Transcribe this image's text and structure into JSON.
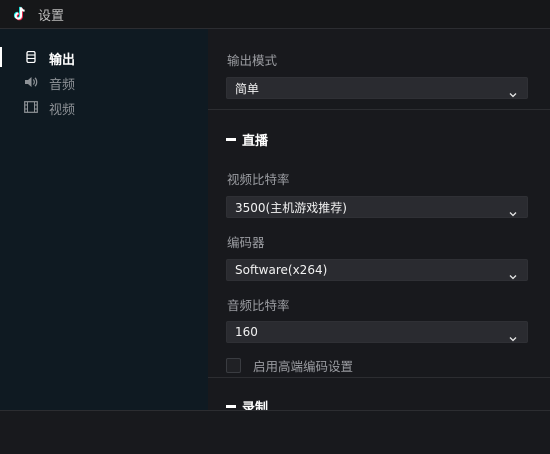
{
  "window": {
    "title": "设置",
    "app_icon": "tiktok-logo-icon"
  },
  "sidebar": {
    "items": [
      {
        "label": "输出",
        "icon": "output-icon",
        "active": true
      },
      {
        "label": "音频",
        "icon": "speaker-icon",
        "active": false
      },
      {
        "label": "视频",
        "icon": "film-icon",
        "active": false
      }
    ]
  },
  "main": {
    "output_mode": {
      "label": "输出模式",
      "value": "简单"
    },
    "live_section": {
      "title": "直播",
      "video_bitrate": {
        "label": "视频比特率",
        "value": "3500(主机游戏推荐)"
      },
      "encoder": {
        "label": "编码器",
        "value": "Software(x264)"
      },
      "audio_bitrate": {
        "label": "音频比特率",
        "value": "160"
      },
      "advanced_encoder": {
        "label": "启用高端编码设置",
        "checked": false
      }
    },
    "record_section": {
      "title": "录制"
    }
  },
  "colors": {
    "sidebar_bg": "#0f1a22",
    "main_bg": "#18191d",
    "select_bg": "#2a2b30"
  }
}
